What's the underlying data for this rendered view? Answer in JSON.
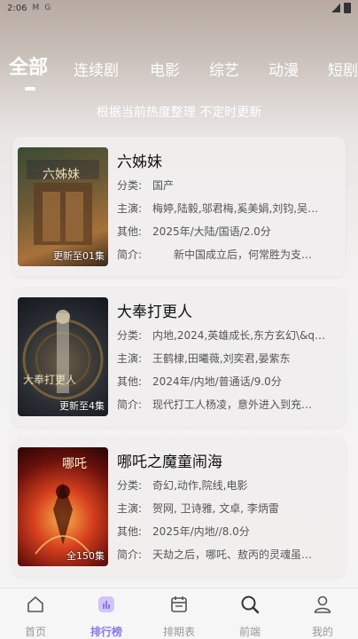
{
  "status_bar": {
    "time": "2:06",
    "icon_label_1": "M",
    "icon_label_2": "G"
  },
  "tabs": [
    "全部",
    "连续剧",
    "电影",
    "综艺",
    "动漫",
    "短剧"
  ],
  "subtitle": "根据当前热度整理 不定时更新",
  "cards": [
    {
      "title": "六姊妹",
      "badge": "更新至01集",
      "poster_art": "六姊妹",
      "category": "分类:　国产",
      "cast": "主演:　梅婷,陆毅,邬君梅,奚美娟,刘钧,吴…",
      "other": "其他:　2025年/大陆/国语/2.0分",
      "intro": "简介:　　　新中国成立后，何常胜为支…",
      "colors": [
        "#2f3a2a",
        "#7d6a3e",
        "#c27a3a"
      ]
    },
    {
      "title": "大奉打更人",
      "badge": "更新至4集",
      "poster_art": "大奉打更人",
      "category": "分类:　内地,2024,英雄成长,东方玄幻\\&q…",
      "cast": "主演:　王鹤棣,田曦薇,刘奕君,晏紫东",
      "other": "其他:　2024年/内地/普通话/9.0分",
      "intro": "简介:　现代打工人杨凌，意外进入到充…",
      "colors": [
        "#1d2530",
        "#4a4f52",
        "#8a6a3a"
      ]
    },
    {
      "title": "哪吒之魔童闹海",
      "badge": "全150集",
      "poster_art": "哪吒",
      "category": "分类:　奇幻,动作,院线,电影",
      "cast": "主演:　贺网, 卫诗雅, 文卓, 李炳雷",
      "other": "其他:　2025年/内地//8.0分",
      "intro": "简介:　天劫之后，哪吒、敖丙的灵魂虽…",
      "colors": [
        "#3a0c0a",
        "#b3271a",
        "#f29a2e"
      ]
    }
  ],
  "bottom_nav": [
    {
      "label": "首页",
      "icon": "home-icon"
    },
    {
      "label": "排行榜",
      "icon": "ranking-icon"
    },
    {
      "label": "排期表",
      "icon": "calendar-icon"
    },
    {
      "label": "前端",
      "icon": "search-icon"
    },
    {
      "label": "我的",
      "icon": "profile-icon"
    }
  ],
  "accent_color": "#8b78e6"
}
